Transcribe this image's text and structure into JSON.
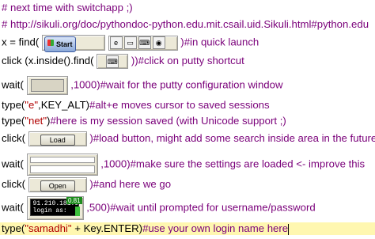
{
  "lines": {
    "l1": "# next time with switchapp ;)",
    "l2": "# http://sikuli.org/doc/pythondoc-python.edu.mit.csail.uid.Sikuli.html#python.edu",
    "l3_pre": "x = find(",
    "l3_thumb": "Start",
    "l3_post": ")#in quick launch",
    "l4_pre": "click (x.inside().find(",
    "l4_post": "))#click on putty shortcut",
    "l5_pre": "wait(",
    "l5_post": ",1000)#wait for the putty configuration window",
    "l6_a": "type(",
    "l6_str": "\"e\"",
    "l6_b": ",KEY_ALT)",
    "l6_c": "#alt+e moves cursor to saved sessions",
    "l7_a": "type(",
    "l7_str": "\"net\"",
    "l7_b": ")",
    "l7_c": "#here is my session saved (with Unicode support ;)",
    "l8_pre": "click(",
    "l8_btn": "Load",
    "l8_post": ")#load button, might add some search inside area in the future",
    "l9_pre": "wait(",
    "l9_post": ",1000)#make sure the settings are loaded <- improve this",
    "l10_pre": "click(",
    "l10_btn": "Open",
    "l10_post": ")#and here we go",
    "l11_pre": "wait(",
    "l11_term1": "91.210.181.96",
    "l11_term2": "login as:",
    "l11_badge": "0.81",
    "l11_post": ",500)#wait until prompted for username/password",
    "l12_a": "type(",
    "l12_str": "\"samadhi\"",
    "l12_b": " + Key.ENTER)",
    "l12_c": "#use your own login name here"
  }
}
